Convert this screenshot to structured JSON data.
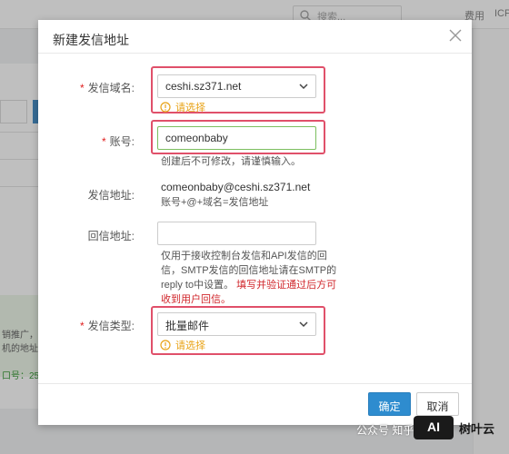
{
  "background": {
    "search_placeholder": "搜索...",
    "nav_items": [
      "费用",
      "ICP"
    ],
    "green_lines": [
      "销推广，订",
      "机的地址，",
      "口号：25"
    ]
  },
  "dialog": {
    "title": "新建发信地址",
    "fields": {
      "domain": {
        "label": "发信域名:",
        "value": "ceshi.sz371.net",
        "warning": "请选择"
      },
      "account": {
        "label": "账号:",
        "value": "comeonbaby",
        "help": "创建后不可修改，请谨慎输入。"
      },
      "address": {
        "label": "发信地址:",
        "value": "comeonbaby@ceshi.sz371.net",
        "help": "账号+@+域名=发信地址"
      },
      "reply": {
        "label": "回信地址:",
        "value": "",
        "help_lines": [
          "仅用于接收控制台发信和API发信的回",
          "信，SMTP发信的回信地址请在SMTP的",
          "reply to中设置。"
        ],
        "help_warning_1": "填写并验证通过后方可",
        "help_warning_2": "收到用户回信。"
      },
      "type": {
        "label": "发信类型:",
        "value": "批量邮件",
        "warning": "请选择"
      }
    },
    "buttons": {
      "confirm": "确定",
      "cancel": "取消"
    }
  },
  "watermark": {
    "zhihu": "公众号 知乎",
    "logo": "AI",
    "brand": "树叶云"
  },
  "colors": {
    "primary": "#2e8ccf",
    "highlight_box": "#e0506a",
    "warning": "#e8a317",
    "error_text": "#d0262b",
    "focus_border": "#7cbf5f"
  }
}
